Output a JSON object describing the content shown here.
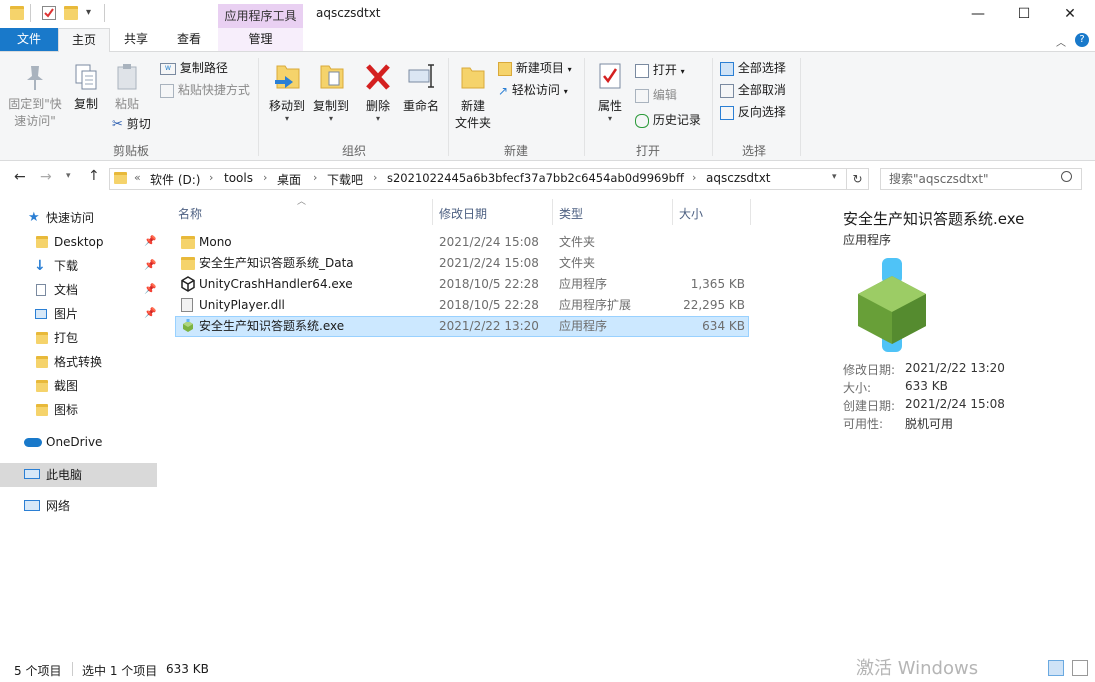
{
  "window": {
    "title": "aqsczsdtxt",
    "context_tab": "应用程序工具",
    "min_glyph": "—",
    "max_glyph": "☐",
    "close_glyph": "✕"
  },
  "tabs": {
    "file": "文件",
    "home": "主页",
    "share": "共享",
    "view": "查看",
    "manage": "管理"
  },
  "ribbon": {
    "clipboard": {
      "label": "剪贴板",
      "pin_quick_line1": "固定到\"快",
      "pin_quick_line2": "速访问\"",
      "copy": "复制",
      "paste": "粘贴",
      "copy_path": "复制路径",
      "paste_shortcut": "粘贴快捷方式",
      "cut": "剪切"
    },
    "organize": {
      "label": "组织",
      "move_to": "移动到",
      "copy_to": "复制到",
      "delete": "删除",
      "rename": "重命名"
    },
    "new": {
      "label": "新建",
      "new_folder_line1": "新建",
      "new_folder_line2": "文件夹",
      "new_item": "新建项目",
      "easy_access": "轻松访问"
    },
    "open": {
      "label": "打开",
      "properties": "属性",
      "open": "打开",
      "edit": "编辑",
      "history": "历史记录"
    },
    "select": {
      "label": "选择",
      "select_all": "全部选择",
      "select_none": "全部取消",
      "invert": "反向选择"
    }
  },
  "address": {
    "overflow": "«",
    "crumbs": [
      "软件 (D:)",
      "tools",
      "桌面",
      "下载吧",
      "s2021022445a6b3bfecf37a7bb2c6454ab0d9969bff",
      "aqsczsdtxt"
    ],
    "search_placeholder": "搜索\"aqsczsdtxt\""
  },
  "nav": {
    "quick_access": "快速访问",
    "items": [
      {
        "label": "Desktop",
        "pinned": true
      },
      {
        "label": "下载",
        "pinned": true
      },
      {
        "label": "文档",
        "pinned": true
      },
      {
        "label": "图片",
        "pinned": true
      },
      {
        "label": "打包",
        "pinned": false
      },
      {
        "label": "格式转换",
        "pinned": false
      },
      {
        "label": "截图",
        "pinned": false
      },
      {
        "label": "图标",
        "pinned": false
      }
    ],
    "onedrive": "OneDrive",
    "this_pc": "此电脑",
    "network": "网络"
  },
  "columns": {
    "name": "名称",
    "modified": "修改日期",
    "type": "类型",
    "size": "大小"
  },
  "files": [
    {
      "name": "Mono",
      "modified": "2021/2/24 15:08",
      "type": "文件夹",
      "size": "",
      "icon": "folder-icon"
    },
    {
      "name": "安全生产知识答题系统_Data",
      "modified": "2021/2/24 15:08",
      "type": "文件夹",
      "size": "",
      "icon": "folder-icon"
    },
    {
      "name": "UnityCrashHandler64.exe",
      "modified": "2018/10/5 22:28",
      "type": "应用程序",
      "size": "1,365 KB",
      "icon": "unity-icon"
    },
    {
      "name": "UnityPlayer.dll",
      "modified": "2018/10/5 22:28",
      "type": "应用程序扩展",
      "size": "22,295 KB",
      "icon": "dll-icon"
    },
    {
      "name": "安全生产知识答题系统.exe",
      "modified": "2021/2/22 13:20",
      "type": "应用程序",
      "size": "634 KB",
      "icon": "app-cube-icon",
      "selected": true
    }
  ],
  "details": {
    "filename": "安全生产知识答题系统.exe",
    "filetype": "应用程序",
    "modified_label": "修改日期:",
    "modified_value": "2021/2/22 13:20",
    "size_label": "大小:",
    "size_value": "633 KB",
    "created_label": "创建日期:",
    "created_value": "2021/2/24 15:08",
    "availability_label": "可用性:",
    "availability_value": "脱机可用"
  },
  "status": {
    "count": "5 个项目",
    "selected": "选中 1 个项目",
    "size": "633 KB",
    "activate": "激活 Windows"
  },
  "colors": {
    "accent": "#1979ca",
    "selection": "#cce8ff",
    "folder": "#f5d36b",
    "context_tab": "#e9d0f2"
  }
}
